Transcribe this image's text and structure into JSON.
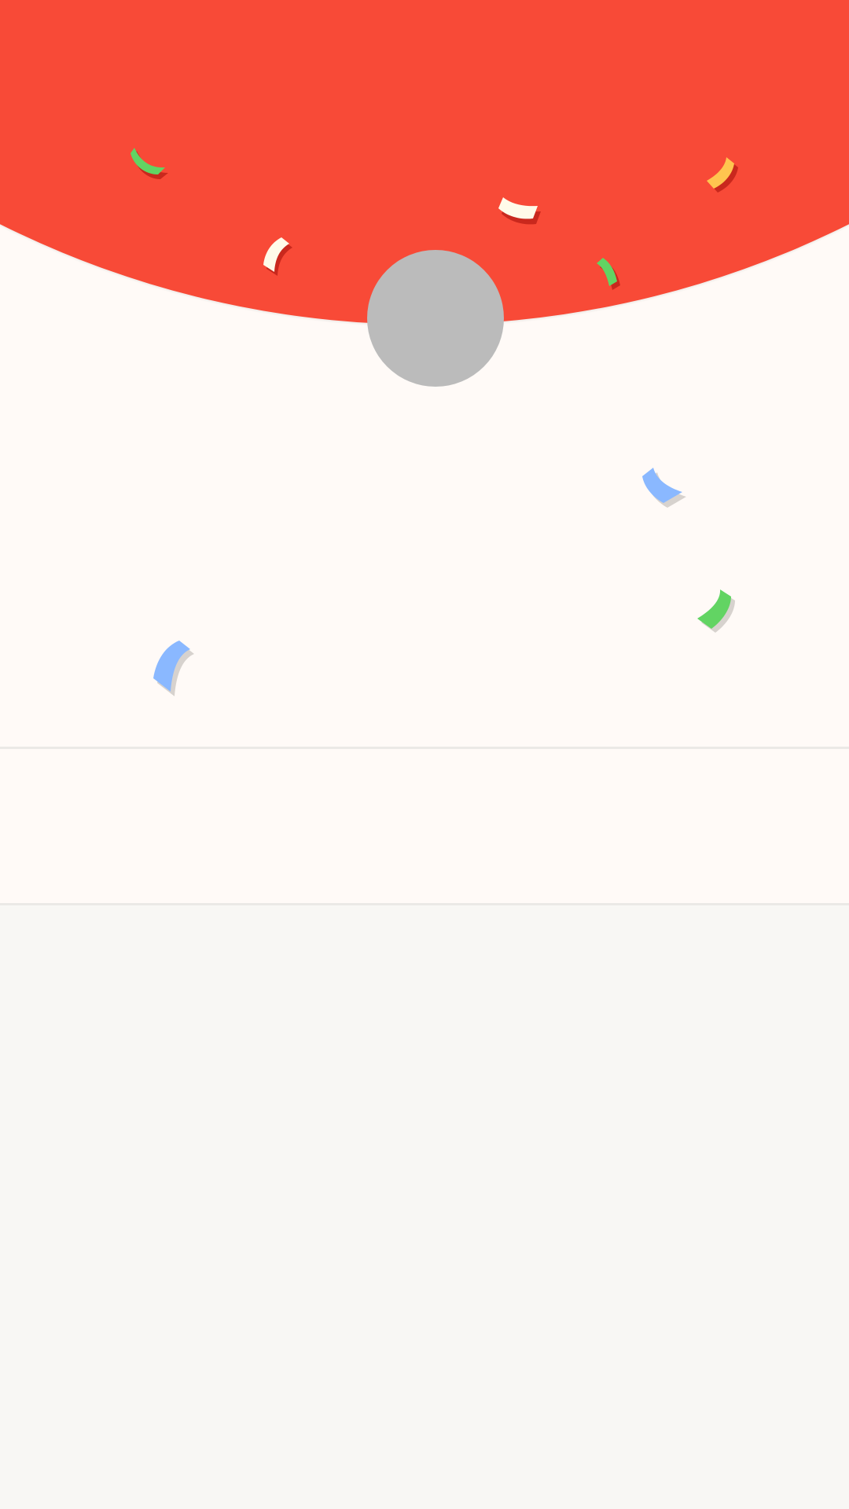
{
  "colors": {
    "header": "#f84a37",
    "surface": "#fffaf7",
    "background": "#f8f7f4",
    "avatar_placeholder": "#bbbbbb",
    "divider": "#ebe9e6",
    "confetti_green": "#62d463",
    "confetti_cream": "#fffbe9",
    "confetti_yellow": "#ffc54f",
    "confetti_blue": "#8ab8ff",
    "shadow_on_red": "#c9281d",
    "shadow_on_light": "#d7d2ce"
  },
  "icons": {
    "avatar": "avatar-placeholder",
    "confetti": "confetti-piece"
  }
}
